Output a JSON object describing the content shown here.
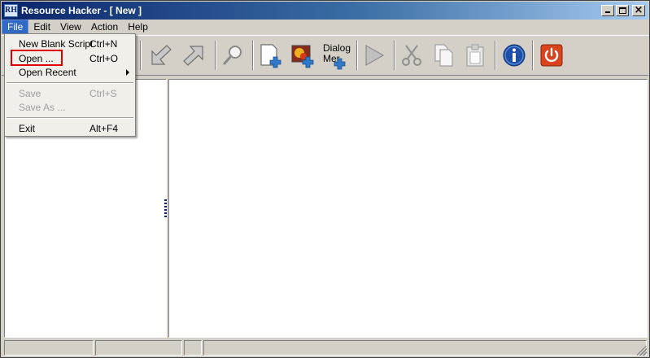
{
  "window": {
    "title": "Resource Hacker - [ New ]",
    "app_icon_text": "RH"
  },
  "menubar": {
    "items": [
      "File",
      "Edit",
      "View",
      "Action",
      "Help"
    ]
  },
  "file_menu": {
    "items": [
      {
        "label": "New Blank Script",
        "shortcut": "Ctrl+N",
        "enabled": true
      },
      {
        "label": "Open ...",
        "shortcut": "Ctrl+O",
        "enabled": true,
        "highlighted": true
      },
      {
        "label": "Open Recent",
        "shortcut": "",
        "enabled": true,
        "submenu": true
      },
      {
        "label": "Save",
        "shortcut": "Ctrl+S",
        "enabled": false
      },
      {
        "label": "Save As ...",
        "shortcut": "",
        "enabled": false
      },
      {
        "label": "Exit",
        "shortcut": "Alt+F4",
        "enabled": true
      }
    ]
  },
  "toolbar": {
    "dialog_label_line1": "Dialog",
    "dialog_label_line2": "Mer",
    "icons": [
      "back-arrow-icon",
      "forward-arrow-icon",
      "search-icon",
      "add-binary-resource-icon",
      "add-image-resource-icon",
      "dialog-menu-add-icon",
      "play-icon",
      "cut-icon",
      "copy-icon",
      "paste-icon",
      "info-icon",
      "power-icon"
    ]
  },
  "colors": {
    "title_start": "#0a246a",
    "title_end": "#a6caf0",
    "menu_highlight": "#316ac5",
    "annotation_red": "#e00000",
    "info_blue": "#1f4fa8",
    "power_red": "#d9431e"
  }
}
